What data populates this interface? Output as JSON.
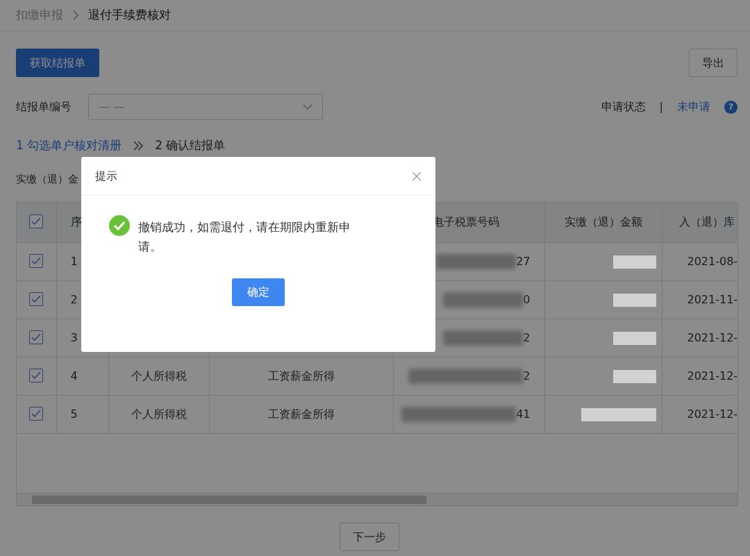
{
  "breadcrumb": [
    {
      "text": "扣缴申报",
      "current": false
    },
    {
      "text": "退付手续费核对",
      "current": true
    }
  ],
  "fetch_button": "获取结报单",
  "export_button": "导出",
  "form": {
    "label": "结报单编号",
    "select": {
      "placeholder": "— —"
    }
  },
  "status": {
    "label": "申请状态",
    "divider": "|",
    "value": "未申请",
    "help": "?"
  },
  "steps": [
    {
      "text": "1 勾选单户核对清册",
      "kind": "link"
    },
    {
      "text": "2 确认结报单",
      "kind": "current"
    }
  ],
  "summary_label": "实缴（退）金",
  "table": {
    "header_checked": true,
    "header": {
      "number": "序",
      "ticket": "电子税票号码",
      "amount": "实缴（退）金额",
      "date": "入（退）库"
    },
    "rows": [
      {
        "checked": true,
        "number": "1",
        "ticket": "27",
        "date": "2021-08-"
      },
      {
        "checked": true,
        "number": "2",
        "ticket": "0",
        "date": "2021-11-"
      },
      {
        "checked": true,
        "number": "3",
        "ticket": "2",
        "date": "2021-12-"
      },
      {
        "checked": true,
        "number": "4",
        "tax_type": "个人所得税",
        "item": "工资薪金所得",
        "ticket": "2",
        "date": "2021-12-"
      },
      {
        "checked": true,
        "number": "5",
        "tax_type": "个人所得税",
        "item": "工资薪金所得",
        "ticket": "41",
        "date": "2021-12-"
      }
    ]
  },
  "next_button": "下一步",
  "dialog": {
    "title": "提示",
    "message": "撤销成功，如需退付，请在期限内重新申请。",
    "ok_button": "确定"
  }
}
